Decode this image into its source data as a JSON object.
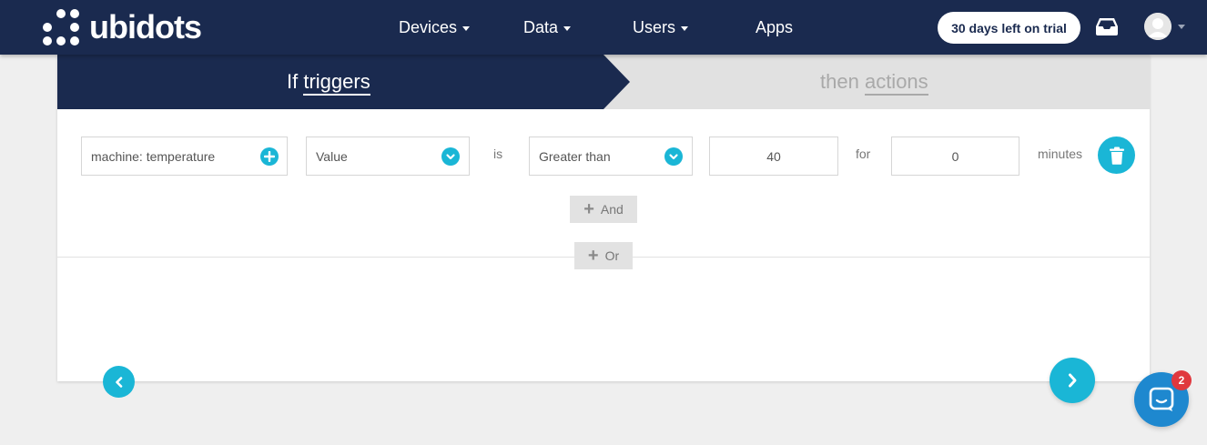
{
  "brand": {
    "name": "ubidots",
    "icon": "ubidots-dots-logo"
  },
  "nav": {
    "items": [
      {
        "label": "Devices",
        "dropdown": true
      },
      {
        "label": "Data",
        "dropdown": true
      },
      {
        "label": "Users",
        "dropdown": true
      },
      {
        "label": "Apps",
        "dropdown": false
      }
    ],
    "trial_label": "30 days left on trial",
    "inbox_icon": "inbox-icon",
    "avatar_icon": "user-avatar-icon"
  },
  "steps": {
    "if_word": "If",
    "if_link": "triggers",
    "then_word": "then",
    "then_link": "actions",
    "active": "if"
  },
  "condition": {
    "variable": "machine: temperature",
    "property": "Value",
    "is_label": "is",
    "operator": "Greater than",
    "value": "40",
    "for_label": "for",
    "duration": "0",
    "unit_label": "minutes"
  },
  "buttons": {
    "and_label": "And",
    "or_label": "Or"
  },
  "chat": {
    "badge": "2"
  },
  "colors": {
    "navbar": "#1a2a4f",
    "accent": "#1ab6d6",
    "chat": "#1e88cf",
    "badge": "#e0383e"
  }
}
